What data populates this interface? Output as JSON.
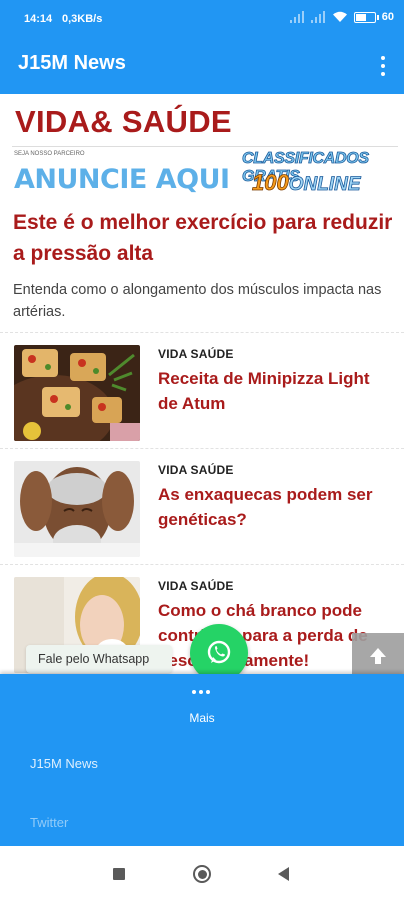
{
  "status_bar": {
    "time": "14:14",
    "network_speed": "0,3KB/s",
    "battery": "60",
    "battery_level": 0.6,
    "icons": [
      "signal-icon",
      "signal-icon",
      "wifi-icon",
      "battery-icon"
    ]
  },
  "app_bar": {
    "title": "J15M News",
    "menu_icon": "more-vertical-icon"
  },
  "section": {
    "title": "VIDA& SAÚDE"
  },
  "banner": {
    "small_text": "SEJA NOSSO PARCEIRO",
    "main_text": "ANUNCIE AQUI",
    "logo_line1": "CLASSIFICADOS GRATIS",
    "logo_number": "100",
    "logo_word": "ONLINE"
  },
  "featured": {
    "headline": "Este é o melhor exercício para reduzir a pressão alta",
    "summary": "Entenda como o alongamento dos músculos impacta nas artérias."
  },
  "articles": [
    {
      "category": "VIDA SAÚDE",
      "title": "Receita de Minipizza Light de Atum"
    },
    {
      "category": "VIDA SAÚDE",
      "title": "As enxaquecas podem ser genéticas?"
    },
    {
      "category": "VIDA SAÚDE",
      "title": "Como o chá branco pode contribuir para a perda de peso rapidamente!"
    }
  ],
  "floating": {
    "whatsapp_label": "Fale pelo Whatsapp",
    "whatsapp_icon": "whatsapp-icon",
    "scroll_top_icon": "arrow-up-icon"
  },
  "bottom_menu": {
    "label": "Mais",
    "items": [
      "J15M News",
      "Twitter"
    ]
  },
  "colors": {
    "primary": "#2196f3",
    "headline_red": "#a91b1b",
    "whatsapp_green": "#25d366"
  }
}
